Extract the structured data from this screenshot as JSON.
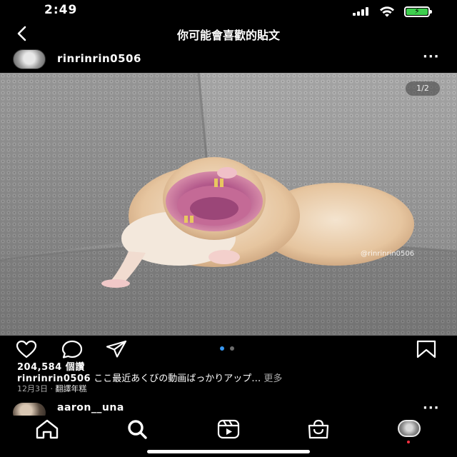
{
  "status_bar": {
    "time": "2:49",
    "battery_color": "#3ecf4e",
    "battery_icon": "charging-bolt"
  },
  "header": {
    "title": "你可能會喜歡的貼文",
    "back_icon": "chevron-left-icon"
  },
  "post": {
    "username": "rinrinrin0506",
    "more_label": "···",
    "page_indicator": "1/2",
    "watermark": "@rinrinrin0506",
    "likes": "204,584 個讚",
    "caption_username": "rinrinrin0506",
    "caption_text": "ここ最近あくびの動画ばっかりアップ…",
    "caption_more": "更多",
    "date": "12月3日",
    "separator": "·",
    "translate": "翻譯年糕",
    "carousel": {
      "count": 2,
      "active": 1,
      "active_color": "#3897f0",
      "inactive_color": "#6b6b6b"
    }
  },
  "next_post": {
    "username": "aaron__una",
    "more_label": "···"
  },
  "tabbar": {
    "items": [
      "home-icon",
      "search-icon",
      "reels-icon",
      "shop-icon",
      "profile-avatar"
    ]
  }
}
